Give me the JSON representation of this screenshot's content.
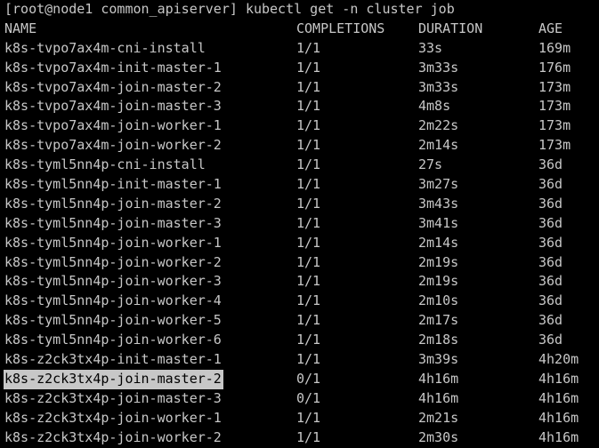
{
  "terminal": {
    "prompt": "[root@node1 common_apiserver]",
    "command": "kubectl get -n cluster job",
    "headers": {
      "name": "NAME",
      "completions": "COMPLETIONS",
      "duration": "DURATION",
      "age": "AGE"
    },
    "rows": [
      {
        "name": "k8s-tvpo7ax4m-cni-install",
        "completions": "1/1",
        "duration": "33s",
        "age": "169m"
      },
      {
        "name": "k8s-tvpo7ax4m-init-master-1",
        "completions": "1/1",
        "duration": "3m33s",
        "age": "176m"
      },
      {
        "name": "k8s-tvpo7ax4m-join-master-2",
        "completions": "1/1",
        "duration": "3m33s",
        "age": "173m"
      },
      {
        "name": "k8s-tvpo7ax4m-join-master-3",
        "completions": "1/1",
        "duration": "4m8s",
        "age": "173m"
      },
      {
        "name": "k8s-tvpo7ax4m-join-worker-1",
        "completions": "1/1",
        "duration": "2m22s",
        "age": "173m"
      },
      {
        "name": "k8s-tvpo7ax4m-join-worker-2",
        "completions": "1/1",
        "duration": "2m14s",
        "age": "173m"
      },
      {
        "name": "k8s-tyml5nn4p-cni-install",
        "completions": "1/1",
        "duration": "27s",
        "age": "36d"
      },
      {
        "name": "k8s-tyml5nn4p-init-master-1",
        "completions": "1/1",
        "duration": "3m27s",
        "age": "36d"
      },
      {
        "name": "k8s-tyml5nn4p-join-master-2",
        "completions": "1/1",
        "duration": "3m43s",
        "age": "36d"
      },
      {
        "name": "k8s-tyml5nn4p-join-master-3",
        "completions": "1/1",
        "duration": "3m41s",
        "age": "36d"
      },
      {
        "name": "k8s-tyml5nn4p-join-worker-1",
        "completions": "1/1",
        "duration": "2m14s",
        "age": "36d"
      },
      {
        "name": "k8s-tyml5nn4p-join-worker-2",
        "completions": "1/1",
        "duration": "2m19s",
        "age": "36d"
      },
      {
        "name": "k8s-tyml5nn4p-join-worker-3",
        "completions": "1/1",
        "duration": "2m19s",
        "age": "36d"
      },
      {
        "name": "k8s-tyml5nn4p-join-worker-4",
        "completions": "1/1",
        "duration": "2m10s",
        "age": "36d"
      },
      {
        "name": "k8s-tyml5nn4p-join-worker-5",
        "completions": "1/1",
        "duration": "2m17s",
        "age": "36d"
      },
      {
        "name": "k8s-tyml5nn4p-join-worker-6",
        "completions": "1/1",
        "duration": "2m18s",
        "age": "36d"
      },
      {
        "name": "k8s-z2ck3tx4p-init-master-1",
        "completions": "1/1",
        "duration": "3m39s",
        "age": "4h20m"
      },
      {
        "name": "k8s-z2ck3tx4p-join-master-2",
        "completions": "0/1",
        "duration": "4h16m",
        "age": "4h16m",
        "selected": true
      },
      {
        "name": "k8s-z2ck3tx4p-join-master-3",
        "completions": "0/1",
        "duration": "4h16m",
        "age": "4h16m"
      },
      {
        "name": "k8s-z2ck3tx4p-join-worker-1",
        "completions": "1/1",
        "duration": "2m21s",
        "age": "4h16m"
      },
      {
        "name": "k8s-z2ck3tx4p-join-worker-2",
        "completions": "1/1",
        "duration": "2m30s",
        "age": "4h16m"
      }
    ],
    "colors": {
      "background": "#000000",
      "foreground": "#c7c7c7",
      "selection_bg": "#c7c7c7",
      "selection_fg": "#000000"
    }
  }
}
